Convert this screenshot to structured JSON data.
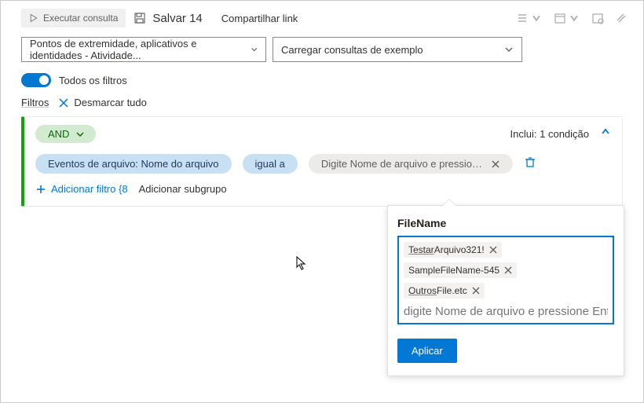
{
  "toolbar": {
    "run_label": "Executar consulta",
    "save_label": "Salvar 14",
    "share_label": "Compartilhar link"
  },
  "dropdowns": {
    "scope_label": "Pontos de extremidade, aplicativos e identidades - Atividade...",
    "samples_label": "Carregar consultas de exemplo"
  },
  "filters_toggle": {
    "label": "Todos os filtros"
  },
  "filters_line": {
    "label": "Filtros",
    "clear_label": "Desmarcar tudo"
  },
  "card": {
    "operator": "AND",
    "includes_label": "Inclui: 1 condição",
    "field_pill": "Eventos de arquivo: Nome do arquivo",
    "op_pill": "igual a",
    "value_pill": "Digite Nome de arquivo e pressione ...",
    "add_filter_label": "Adicionar filtro {8",
    "add_sub_label": "Adicionar subgrupo"
  },
  "popup": {
    "title": "FileName",
    "chips": [
      {
        "prefix": "Testar",
        "rest": "Arquivo321!"
      },
      {
        "prefix": "",
        "rest": "SampleFileName-545"
      },
      {
        "prefix": "Outros",
        "rest": "File.etc"
      }
    ],
    "placeholder": "digite Nome de arquivo e pressione Enter",
    "apply_label": "Aplicar"
  }
}
